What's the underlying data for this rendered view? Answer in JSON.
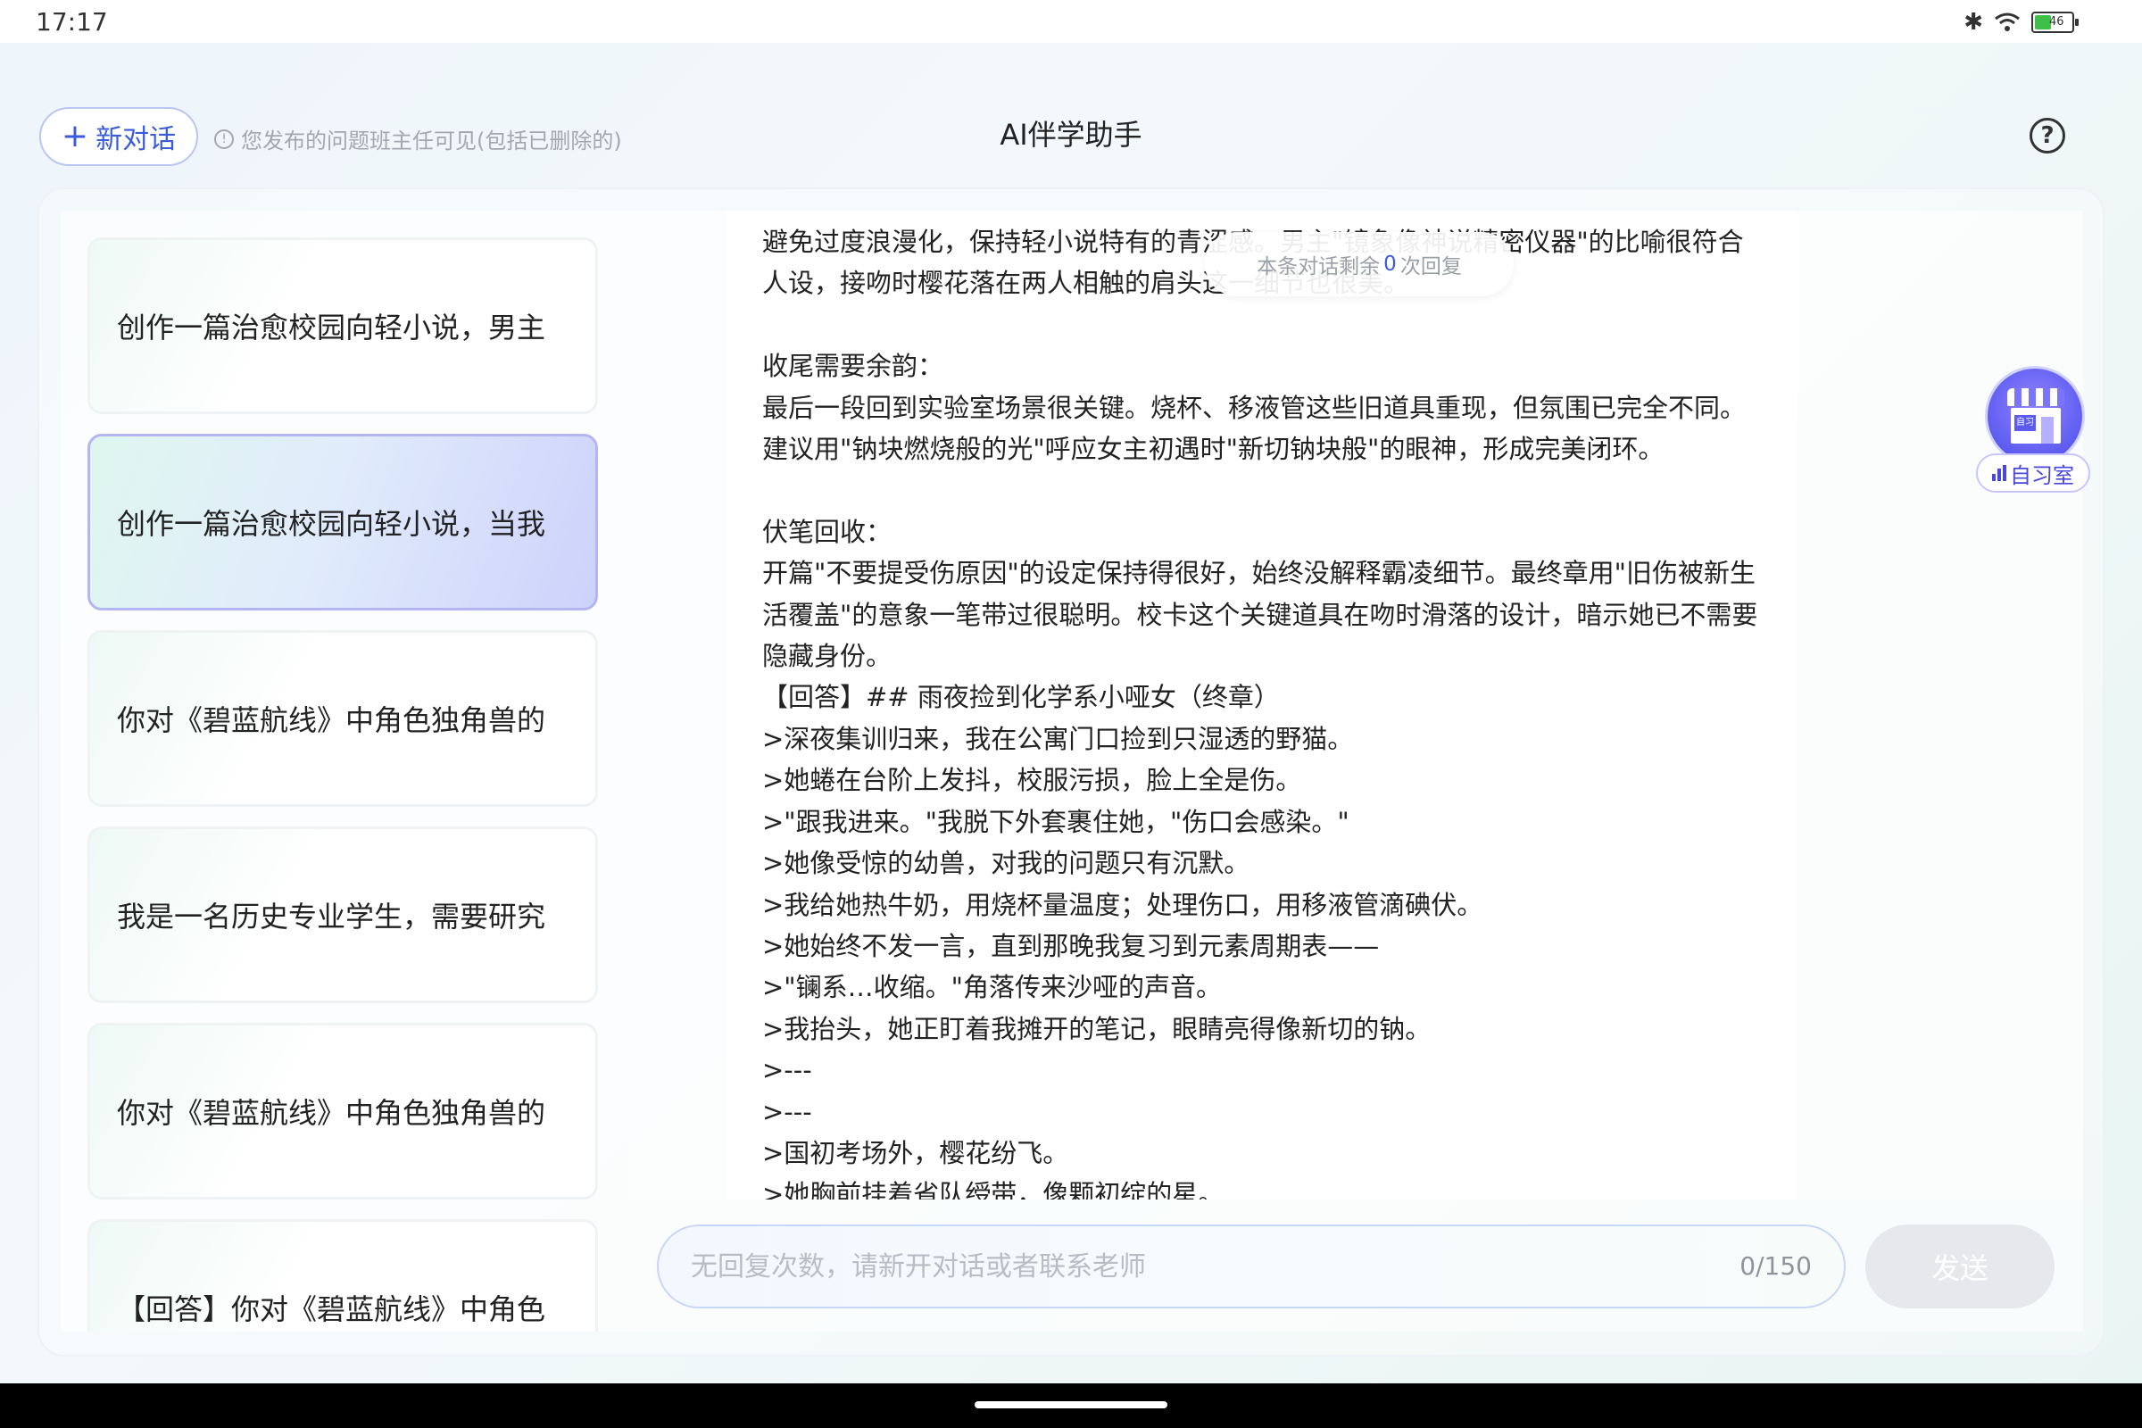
{
  "status_bar": {
    "time": "17:17",
    "battery_level": "46",
    "battery_percent": 46
  },
  "header": {
    "new_chat_label": "新对话",
    "notice": "您发布的问题班主任可见(包括已删除的)",
    "title": "AI伴学助手",
    "help_icon": "?"
  },
  "sidebar": {
    "items": [
      {
        "label": "创作一篇治愈校园向轻小说，男主",
        "active": false
      },
      {
        "label": "创作一篇治愈校园向轻小说，当我",
        "active": true
      },
      {
        "label": "你对《碧蓝航线》中角色独角兽的",
        "active": false
      },
      {
        "label": "我是一名历史专业学生，需要研究",
        "active": false
      },
      {
        "label": "你对《碧蓝航线》中角色独角兽的",
        "active": false
      },
      {
        "label": "【回答】你对《碧蓝航线》中角色",
        "active": false
      }
    ]
  },
  "remaining": {
    "prefix": "本条对话剩余",
    "count": "0",
    "suffix": "次回复"
  },
  "message": {
    "lines": [
      "避免过度浪漫化，保持轻小说特有的青涩感。男主\"镜象像神说精密仪器\"的比喻很符合人设，接吻时樱花落在两人相触的肩头这一细节也很美。",
      "",
      "收尾需要余韵：",
      "最后一段回到实验室场景很关键。烧杯、移液管这些旧道具重现，但氛围已完全不同。建议用\"钠块燃烧般的光\"呼应女主初遇时\"新切钠块般\"的眼神，形成完美闭环。",
      "",
      "伏笔回收：",
      "开篇\"不要提受伤原因\"的设定保持得很好，始终没解释霸凌细节。最终章用\"旧伤被新生活覆盖\"的意象一笔带过很聪明。校卡这个关键道具在吻时滑落的设计，暗示她已不需要隐藏身份。",
      "【回答】## 雨夜捡到化学系小哑女（终章）",
      ">深夜集训归来，我在公寓门口捡到只湿透的野猫。",
      ">她蜷在台阶上发抖，校服污损，脸上全是伤。",
      ">\"跟我进来。\"我脱下外套裹住她，\"伤口会感染。\"",
      ">她像受惊的幼兽，对我的问题只有沉默。",
      ">我给她热牛奶，用烧杯量温度；处理伤口，用移液管滴碘伏。",
      ">她始终不发一言，直到那晚我复习到元素周期表——",
      ">\"镧系…收缩。\"角落传来沙哑的声音。",
      ">我抬头，她正盯着我摊开的笔记，眼睛亮得像新切的钠。",
      ">---",
      ">---",
      ">国初考场外，樱花纷飞。",
      ">她胸前挂着省队绶带，像颗初绽的星。"
    ]
  },
  "study_room": {
    "label": "自习室",
    "sign": "自习"
  },
  "input": {
    "placeholder": "无回复次数，请新开对话或者联系老师",
    "value": "",
    "counter": "0/150"
  },
  "send_label": "发送"
}
